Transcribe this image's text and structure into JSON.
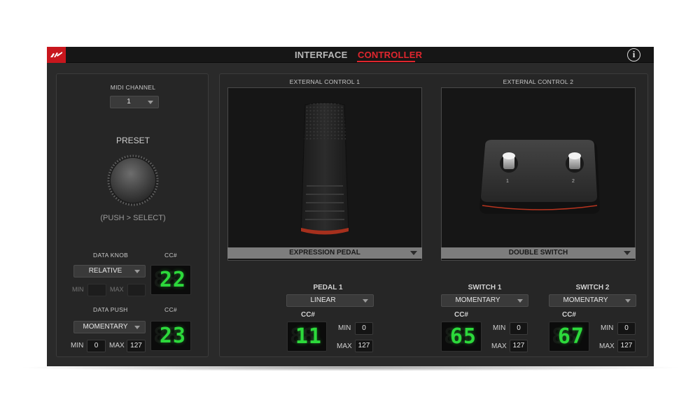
{
  "header": {
    "tabs": [
      {
        "label": "INTERFACE",
        "active": false
      },
      {
        "label": "CONTROLLER",
        "active": true
      }
    ],
    "info_glyph": "i",
    "accent_color": "#e0262e",
    "logo_color": "#c8161d"
  },
  "left": {
    "midi_channel_label": "MIDI CHANNEL",
    "midi_channel_value": "1",
    "preset_label": "PRESET",
    "preset_hint": "(PUSH > SELECT)",
    "data_knob_label": "DATA KNOB",
    "data_knob_mode": "RELATIVE",
    "cc_label": "CC#",
    "data_knob_cc": "22",
    "knob_min_label": "MIN",
    "knob_max_label": "MAX",
    "data_push_label": "DATA PUSH",
    "data_push_mode": "MOMENTARY",
    "data_push_cc": "23",
    "push_min_label": "MIN",
    "push_min_value": "0",
    "push_max_label": "MAX",
    "push_max_value": "127"
  },
  "ext1": {
    "title": "EXTERNAL CONTROL 1",
    "device": "EXPRESSION PEDAL",
    "pedal_label": "PEDAL 1",
    "pedal_mode": "LINEAR",
    "cc_label": "CC#",
    "cc_value": "11",
    "min_label": "MIN",
    "min_value": "0",
    "max_label": "MAX",
    "max_value": "127"
  },
  "ext2": {
    "title": "EXTERNAL CONTROL 2",
    "device": "DOUBLE SWITCH",
    "switch_numbers": [
      "1",
      "2"
    ],
    "switch1": {
      "label": "SWITCH 1",
      "mode": "MOMENTARY",
      "cc_label": "CC#",
      "cc_value": "65",
      "min_label": "MIN",
      "min_value": "0",
      "max_label": "MAX",
      "max_value": "127"
    },
    "switch2": {
      "label": "SWITCH 2",
      "mode": "MOMENTARY",
      "cc_label": "CC#",
      "cc_value": "67",
      "min_label": "MIN",
      "min_value": "0",
      "max_label": "MAX",
      "max_value": "127"
    }
  },
  "segment_ghost": "88",
  "segment_color": "#2cd93b"
}
